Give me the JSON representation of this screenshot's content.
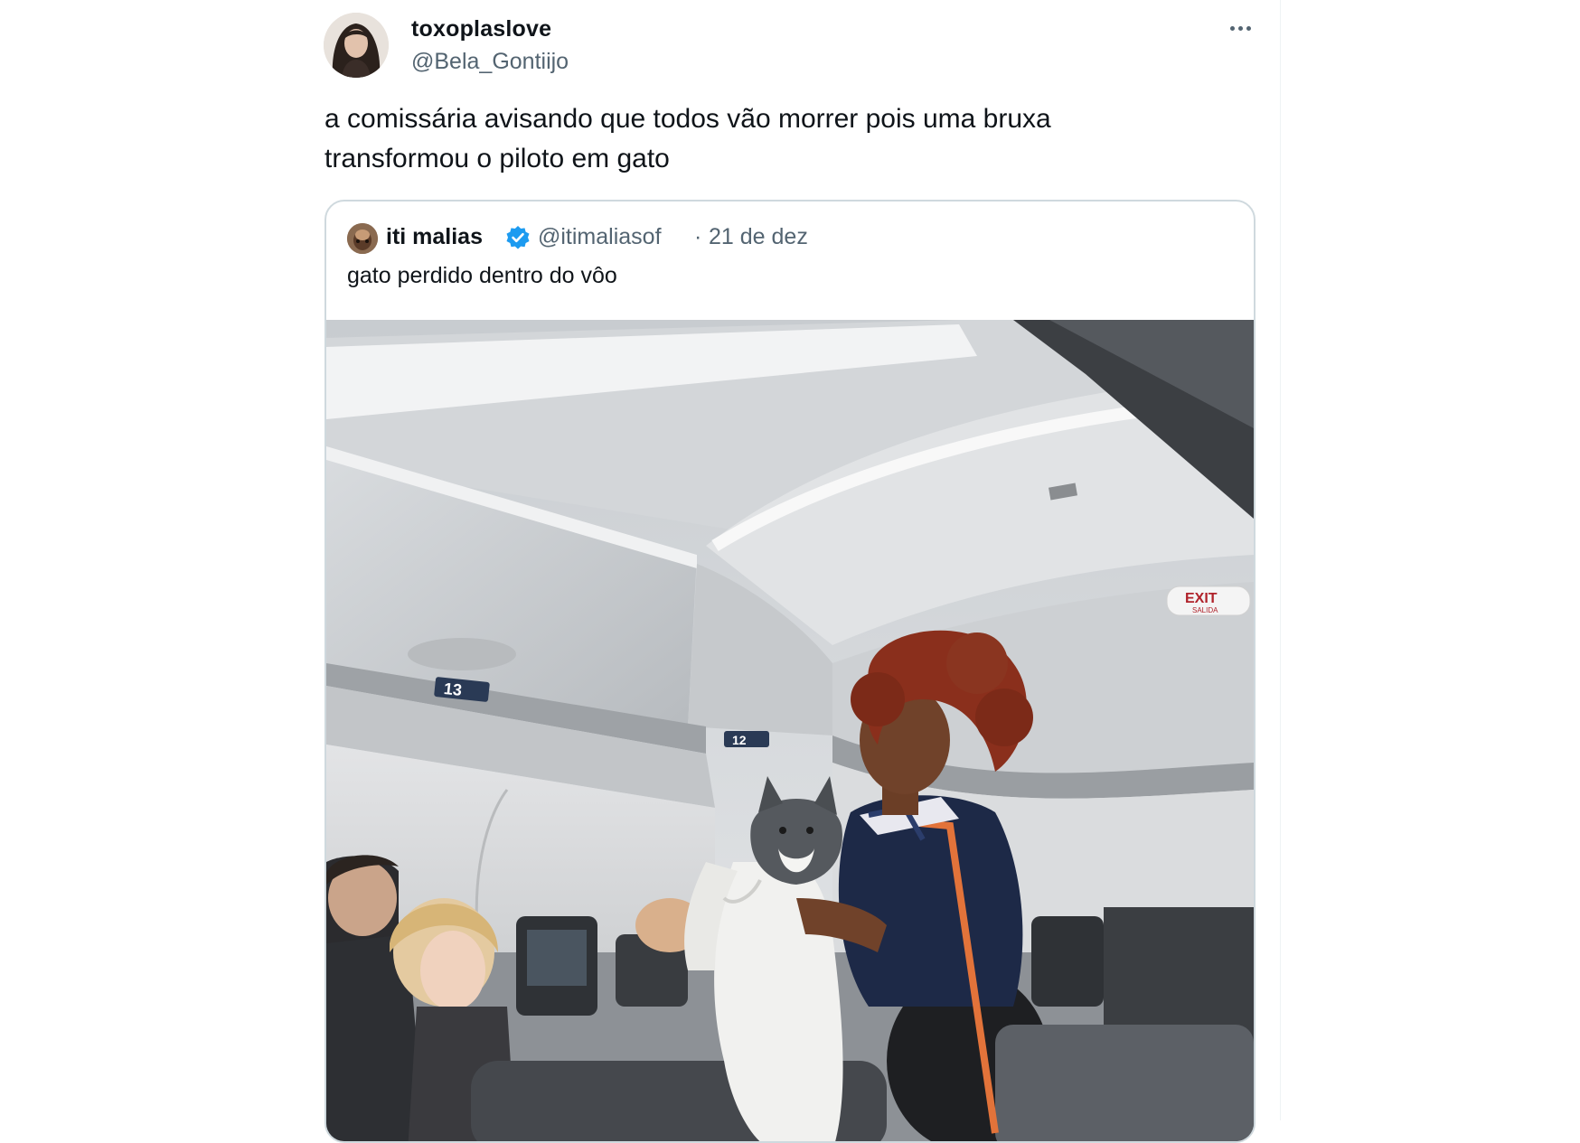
{
  "tweet": {
    "author_name": "toxoplaslove",
    "author_handle": "@Bela_Gontiijo",
    "text": "a comissária avisando que todos vão morrer pois uma bruxa\ntransformou o piloto em gato",
    "more_icon": "more-horizontal-icon"
  },
  "quote": {
    "author_name": "iti malias",
    "verified_icon": "verified-badge-icon",
    "author_handle": "@itimaliasof",
    "separator": "·",
    "date": "21 de dez",
    "text": "gato perdido dentro do vôo",
    "media": {
      "row_number_left": "13",
      "row_number_right": "12",
      "exit_sign": "EXIT",
      "exit_sign_sub": "SALIDA"
    }
  },
  "colors": {
    "text_primary": "#0f1419",
    "text_secondary": "#536471",
    "border": "#cfd9de",
    "verified_blue": "#1d9bf0"
  }
}
